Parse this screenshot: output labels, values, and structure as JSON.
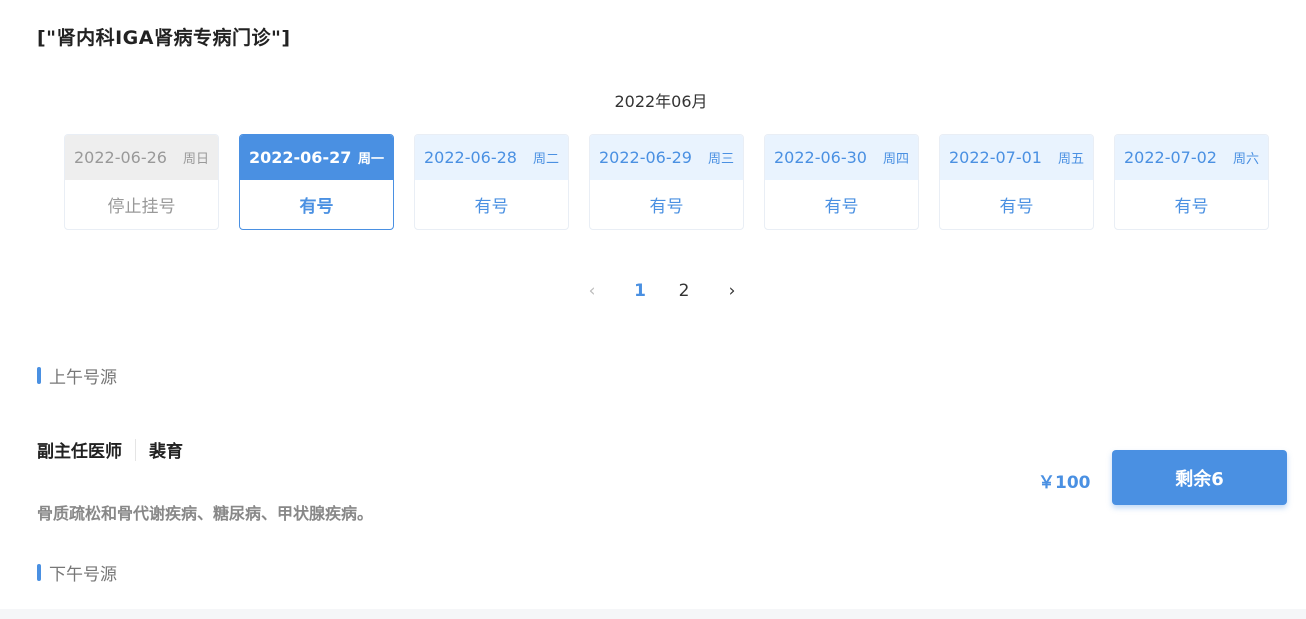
{
  "page_title": "[\"肾内科IGA肾病专病门诊\"]",
  "month": "2022年06月",
  "days": [
    {
      "date": "2022-06-26",
      "weekday": "周日",
      "status": "停止挂号"
    },
    {
      "date": "2022-06-27",
      "weekday": "周一",
      "status": "有号"
    },
    {
      "date": "2022-06-28",
      "weekday": "周二",
      "status": "有号"
    },
    {
      "date": "2022-06-29",
      "weekday": "周三",
      "status": "有号"
    },
    {
      "date": "2022-06-30",
      "weekday": "周四",
      "status": "有号"
    },
    {
      "date": "2022-07-01",
      "weekday": "周五",
      "status": "有号"
    },
    {
      "date": "2022-07-02",
      "weekday": "周六",
      "status": "有号"
    }
  ],
  "pagination": {
    "prev": "‹",
    "pages": [
      "1",
      "2"
    ],
    "current": "1",
    "next": "›"
  },
  "morning": {
    "label": "上午号源",
    "slots": [
      {
        "title": "副主任医师",
        "doctor": "裴育",
        "specialty": "骨质疏松和骨代谢疾病、糖尿病、甲状腺疾病。",
        "price": "￥100",
        "remaining": "剩余6"
      }
    ]
  },
  "afternoon": {
    "label": "下午号源"
  },
  "colors": {
    "accent": "#4a90e2",
    "accent_light": "#e9f3fe",
    "stopped": "#eeeeee"
  }
}
